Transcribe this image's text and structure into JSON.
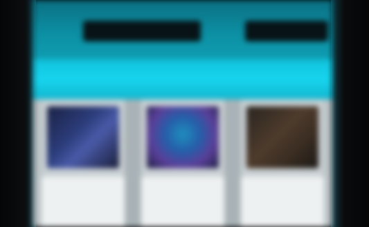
{
  "header": {
    "nav_left": "",
    "nav_right": ""
  },
  "banner": {
    "title": ""
  },
  "tiles": [
    {
      "caption": ""
    },
    {
      "caption": ""
    },
    {
      "caption": ""
    }
  ],
  "colors": {
    "header": "#0c8fa3",
    "banner": "#17d4ee",
    "nav_pill": "#071316",
    "tile_bg": "#c9d0d3",
    "caption_bg": "#eef1f2"
  }
}
